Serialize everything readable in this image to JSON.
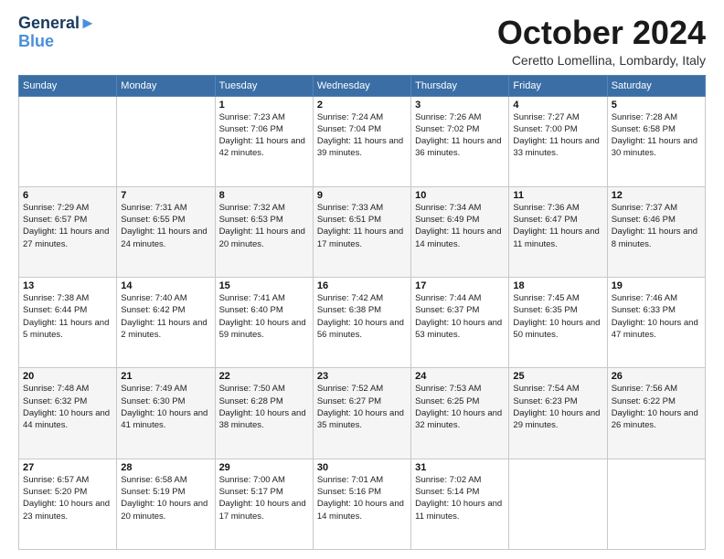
{
  "logo": {
    "line1": "General",
    "line2": "Blue"
  },
  "title": "October 2024",
  "location": "Ceretto Lomellina, Lombardy, Italy",
  "weekdays": [
    "Sunday",
    "Monday",
    "Tuesday",
    "Wednesday",
    "Thursday",
    "Friday",
    "Saturday"
  ],
  "weeks": [
    [
      {
        "day": "",
        "sunrise": "",
        "sunset": "",
        "daylight": ""
      },
      {
        "day": "",
        "sunrise": "",
        "sunset": "",
        "daylight": ""
      },
      {
        "day": "1",
        "sunrise": "Sunrise: 7:23 AM",
        "sunset": "Sunset: 7:06 PM",
        "daylight": "Daylight: 11 hours and 42 minutes."
      },
      {
        "day": "2",
        "sunrise": "Sunrise: 7:24 AM",
        "sunset": "Sunset: 7:04 PM",
        "daylight": "Daylight: 11 hours and 39 minutes."
      },
      {
        "day": "3",
        "sunrise": "Sunrise: 7:26 AM",
        "sunset": "Sunset: 7:02 PM",
        "daylight": "Daylight: 11 hours and 36 minutes."
      },
      {
        "day": "4",
        "sunrise": "Sunrise: 7:27 AM",
        "sunset": "Sunset: 7:00 PM",
        "daylight": "Daylight: 11 hours and 33 minutes."
      },
      {
        "day": "5",
        "sunrise": "Sunrise: 7:28 AM",
        "sunset": "Sunset: 6:58 PM",
        "daylight": "Daylight: 11 hours and 30 minutes."
      }
    ],
    [
      {
        "day": "6",
        "sunrise": "Sunrise: 7:29 AM",
        "sunset": "Sunset: 6:57 PM",
        "daylight": "Daylight: 11 hours and 27 minutes."
      },
      {
        "day": "7",
        "sunrise": "Sunrise: 7:31 AM",
        "sunset": "Sunset: 6:55 PM",
        "daylight": "Daylight: 11 hours and 24 minutes."
      },
      {
        "day": "8",
        "sunrise": "Sunrise: 7:32 AM",
        "sunset": "Sunset: 6:53 PM",
        "daylight": "Daylight: 11 hours and 20 minutes."
      },
      {
        "day": "9",
        "sunrise": "Sunrise: 7:33 AM",
        "sunset": "Sunset: 6:51 PM",
        "daylight": "Daylight: 11 hours and 17 minutes."
      },
      {
        "day": "10",
        "sunrise": "Sunrise: 7:34 AM",
        "sunset": "Sunset: 6:49 PM",
        "daylight": "Daylight: 11 hours and 14 minutes."
      },
      {
        "day": "11",
        "sunrise": "Sunrise: 7:36 AM",
        "sunset": "Sunset: 6:47 PM",
        "daylight": "Daylight: 11 hours and 11 minutes."
      },
      {
        "day": "12",
        "sunrise": "Sunrise: 7:37 AM",
        "sunset": "Sunset: 6:46 PM",
        "daylight": "Daylight: 11 hours and 8 minutes."
      }
    ],
    [
      {
        "day": "13",
        "sunrise": "Sunrise: 7:38 AM",
        "sunset": "Sunset: 6:44 PM",
        "daylight": "Daylight: 11 hours and 5 minutes."
      },
      {
        "day": "14",
        "sunrise": "Sunrise: 7:40 AM",
        "sunset": "Sunset: 6:42 PM",
        "daylight": "Daylight: 11 hours and 2 minutes."
      },
      {
        "day": "15",
        "sunrise": "Sunrise: 7:41 AM",
        "sunset": "Sunset: 6:40 PM",
        "daylight": "Daylight: 10 hours and 59 minutes."
      },
      {
        "day": "16",
        "sunrise": "Sunrise: 7:42 AM",
        "sunset": "Sunset: 6:38 PM",
        "daylight": "Daylight: 10 hours and 56 minutes."
      },
      {
        "day": "17",
        "sunrise": "Sunrise: 7:44 AM",
        "sunset": "Sunset: 6:37 PM",
        "daylight": "Daylight: 10 hours and 53 minutes."
      },
      {
        "day": "18",
        "sunrise": "Sunrise: 7:45 AM",
        "sunset": "Sunset: 6:35 PM",
        "daylight": "Daylight: 10 hours and 50 minutes."
      },
      {
        "day": "19",
        "sunrise": "Sunrise: 7:46 AM",
        "sunset": "Sunset: 6:33 PM",
        "daylight": "Daylight: 10 hours and 47 minutes."
      }
    ],
    [
      {
        "day": "20",
        "sunrise": "Sunrise: 7:48 AM",
        "sunset": "Sunset: 6:32 PM",
        "daylight": "Daylight: 10 hours and 44 minutes."
      },
      {
        "day": "21",
        "sunrise": "Sunrise: 7:49 AM",
        "sunset": "Sunset: 6:30 PM",
        "daylight": "Daylight: 10 hours and 41 minutes."
      },
      {
        "day": "22",
        "sunrise": "Sunrise: 7:50 AM",
        "sunset": "Sunset: 6:28 PM",
        "daylight": "Daylight: 10 hours and 38 minutes."
      },
      {
        "day": "23",
        "sunrise": "Sunrise: 7:52 AM",
        "sunset": "Sunset: 6:27 PM",
        "daylight": "Daylight: 10 hours and 35 minutes."
      },
      {
        "day": "24",
        "sunrise": "Sunrise: 7:53 AM",
        "sunset": "Sunset: 6:25 PM",
        "daylight": "Daylight: 10 hours and 32 minutes."
      },
      {
        "day": "25",
        "sunrise": "Sunrise: 7:54 AM",
        "sunset": "Sunset: 6:23 PM",
        "daylight": "Daylight: 10 hours and 29 minutes."
      },
      {
        "day": "26",
        "sunrise": "Sunrise: 7:56 AM",
        "sunset": "Sunset: 6:22 PM",
        "daylight": "Daylight: 10 hours and 26 minutes."
      }
    ],
    [
      {
        "day": "27",
        "sunrise": "Sunrise: 6:57 AM",
        "sunset": "Sunset: 5:20 PM",
        "daylight": "Daylight: 10 hours and 23 minutes."
      },
      {
        "day": "28",
        "sunrise": "Sunrise: 6:58 AM",
        "sunset": "Sunset: 5:19 PM",
        "daylight": "Daylight: 10 hours and 20 minutes."
      },
      {
        "day": "29",
        "sunrise": "Sunrise: 7:00 AM",
        "sunset": "Sunset: 5:17 PM",
        "daylight": "Daylight: 10 hours and 17 minutes."
      },
      {
        "day": "30",
        "sunrise": "Sunrise: 7:01 AM",
        "sunset": "Sunset: 5:16 PM",
        "daylight": "Daylight: 10 hours and 14 minutes."
      },
      {
        "day": "31",
        "sunrise": "Sunrise: 7:02 AM",
        "sunset": "Sunset: 5:14 PM",
        "daylight": "Daylight: 10 hours and 11 minutes."
      },
      {
        "day": "",
        "sunrise": "",
        "sunset": "",
        "daylight": ""
      },
      {
        "day": "",
        "sunrise": "",
        "sunset": "",
        "daylight": ""
      }
    ]
  ]
}
